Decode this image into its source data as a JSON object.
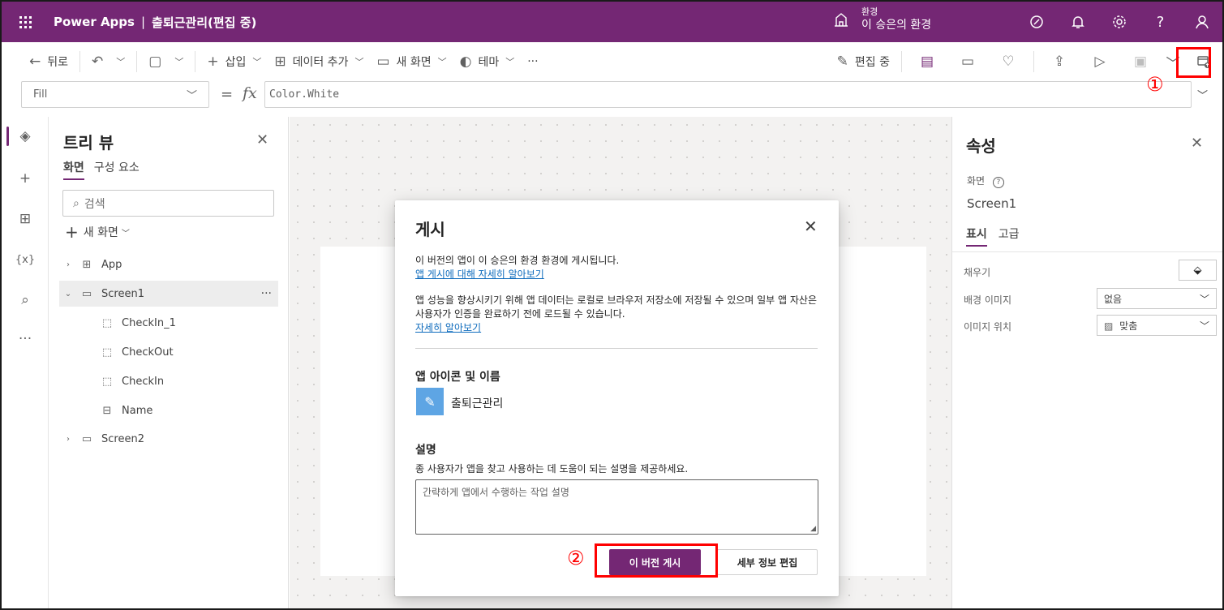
{
  "titlebar": {
    "app_name": "Power Apps",
    "separator": "|",
    "doc_title": "출퇴근관리(편집 중)",
    "env_label": "환경",
    "env_name": "이 승은의 환경"
  },
  "command_bar": {
    "back": "뒤로",
    "insert": "삽입",
    "add_data": "데이터 추가",
    "new_screen": "새 화면",
    "theme": "테마",
    "more": "···",
    "editing": "편집 중"
  },
  "formula_bar": {
    "property": "Fill",
    "equals": "=",
    "fx": "fx",
    "formula": "Color.White"
  },
  "tree_view": {
    "title": "트리 뷰",
    "tabs": [
      "화면",
      "구성 요소"
    ],
    "search_placeholder": "검색",
    "new_screen": "새 화면",
    "nodes": [
      {
        "label": "App"
      },
      {
        "label": "Screen1",
        "more": "···"
      },
      {
        "label": "CheckIn_1"
      },
      {
        "label": "CheckOut"
      },
      {
        "label": "CheckIn"
      },
      {
        "label": "Name"
      },
      {
        "label": "Screen2"
      }
    ]
  },
  "properties": {
    "title": "속성",
    "type_label": "화면",
    "screen_name": "Screen1",
    "tabs": [
      "표시",
      "고급"
    ],
    "fill_label": "채우기",
    "bg_image_label": "배경 이미지",
    "bg_image_value": "없음",
    "image_position_label": "이미지 위치",
    "image_position_value": "맞춤"
  },
  "dialog": {
    "title": "게시",
    "line1": "이 버전의 앱이 이 승은의 환경 환경에 게시됩니다.",
    "link1": "앱 게시에 대해 자세히 알아보기",
    "line2": "앱 성능을 향상시키기 위해 앱 데이터는 로컬로 브라우저 저장소에 저장될 수 있으며 일부 앱 자산은 사용자가 인증을 완료하기 전에 로드될 수 있습니다.",
    "link2": "자세히 알아보기",
    "icon_section": "앱 아이콘 및 이름",
    "app_name": "출퇴근관리",
    "desc_section": "설명",
    "desc_hint": "종 사용자가 앱을 찾고 사용하는 데 도움이 되는 설명을 제공하세요.",
    "desc_placeholder": "간략하게 앱에서 수행하는 작업 설명",
    "publish_button": "이 버전 게시",
    "edit_details_button": "세부 정보 편집"
  },
  "annotations": {
    "marker1": "①",
    "marker2": "②",
    "highlight_color": "#ff0000"
  },
  "colors": {
    "brand": "#742774",
    "link": "#0f6cbd"
  }
}
